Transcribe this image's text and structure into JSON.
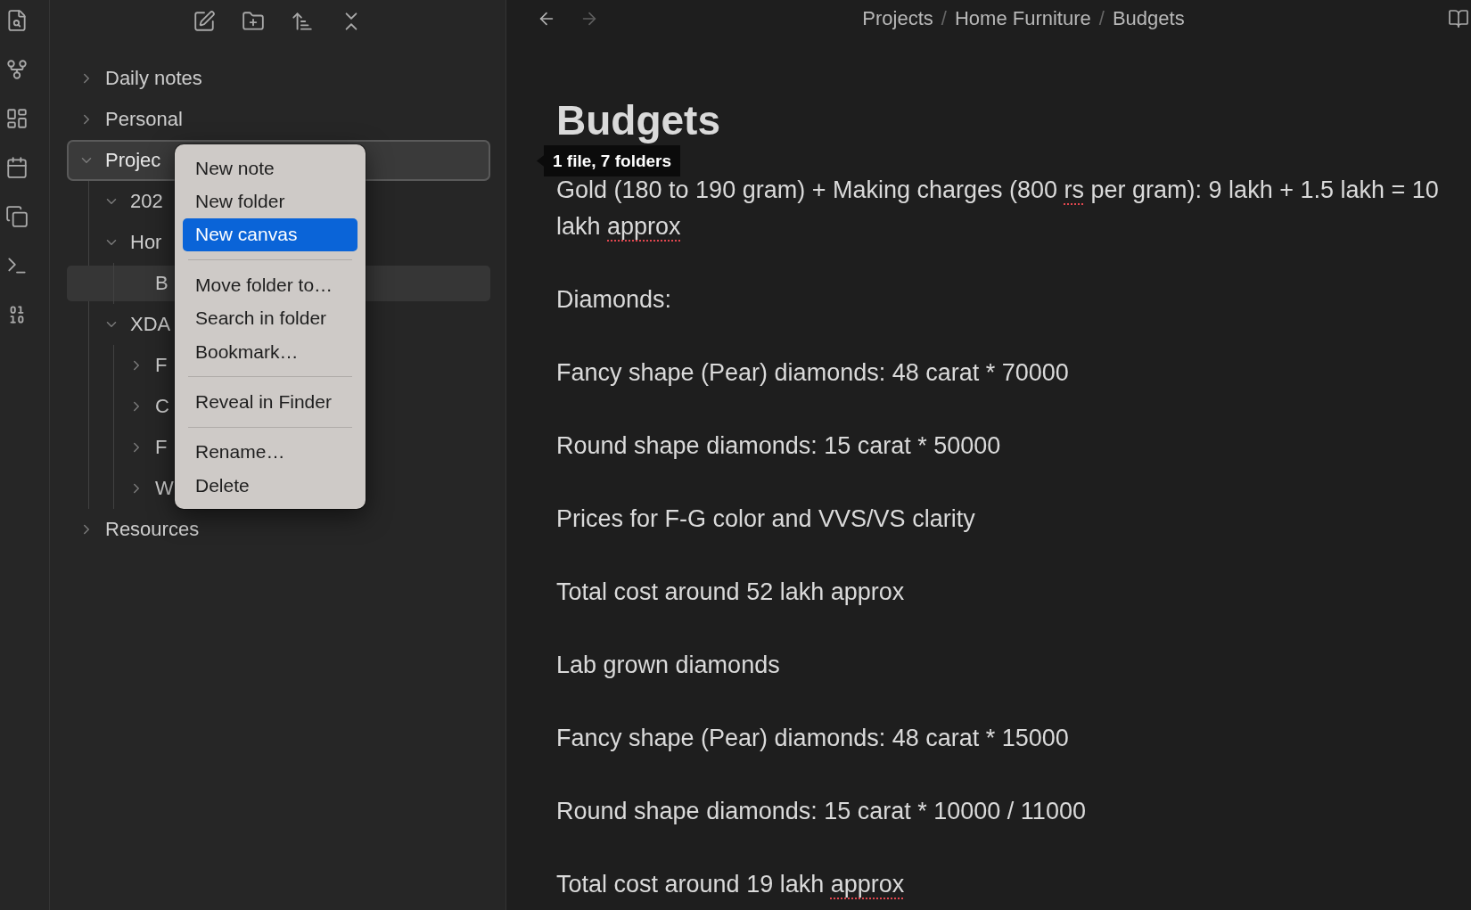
{
  "sidebar": {
    "tree": [
      {
        "label": "Daily notes",
        "kind": "folder",
        "expanded": false,
        "selected": false,
        "active": false
      },
      {
        "label": "Personal",
        "kind": "folder",
        "expanded": false,
        "selected": false,
        "active": false
      },
      {
        "label": "Projec",
        "kind": "folder",
        "expanded": true,
        "selected": true,
        "active": false,
        "children": [
          {
            "label": "202",
            "kind": "folder",
            "expanded": true,
            "selected": false,
            "active": false
          },
          {
            "label": "Hor",
            "kind": "folder",
            "expanded": true,
            "selected": false,
            "active": false,
            "children": [
              {
                "label": "B",
                "kind": "file",
                "selected": false,
                "active": true
              }
            ]
          },
          {
            "label": "XDA",
            "kind": "folder",
            "expanded": true,
            "selected": false,
            "active": false,
            "children": [
              {
                "label": "F",
                "kind": "folder",
                "expanded": false,
                "selected": false,
                "active": false
              },
              {
                "label": "C",
                "kind": "folder",
                "expanded": false,
                "selected": false,
                "active": false
              },
              {
                "label": "F",
                "kind": "folder",
                "expanded": false,
                "selected": false,
                "active": false
              },
              {
                "label": "W",
                "kind": "folder",
                "expanded": false,
                "selected": false,
                "active": false
              }
            ]
          }
        ]
      },
      {
        "label": "Resources",
        "kind": "folder",
        "expanded": false,
        "selected": false,
        "active": false
      }
    ]
  },
  "context_menu": {
    "items": [
      {
        "kind": "item",
        "label": "New note",
        "selected": false
      },
      {
        "kind": "item",
        "label": "New folder",
        "selected": false
      },
      {
        "kind": "item",
        "label": "New canvas",
        "selected": true
      },
      {
        "kind": "separator"
      },
      {
        "kind": "item",
        "label": "Move folder to…",
        "selected": false
      },
      {
        "kind": "item",
        "label": "Search in folder",
        "selected": false
      },
      {
        "kind": "item",
        "label": "Bookmark…",
        "selected": false
      },
      {
        "kind": "separator"
      },
      {
        "kind": "item",
        "label": "Reveal in Finder",
        "selected": false
      },
      {
        "kind": "separator"
      },
      {
        "kind": "item",
        "label": "Rename…",
        "selected": false
      },
      {
        "kind": "item",
        "label": "Delete",
        "selected": false
      }
    ]
  },
  "history_buttons": [
    {
      "kind": "back",
      "disabled": false
    },
    {
      "kind": "forward",
      "disabled": true
    }
  ],
  "breadcrumb": [
    {
      "kind": "link",
      "text": "Projects"
    },
    {
      "kind": "separator",
      "text": "/"
    },
    {
      "kind": "link",
      "text": "Home Furniture"
    },
    {
      "kind": "separator",
      "text": "/"
    },
    {
      "kind": "link",
      "text": "Budgets"
    }
  ],
  "note": {
    "title": "Budgets",
    "paragraphs": [
      {
        "segments": [
          {
            "text": "Gold (180 to 190 gram) + Making charges (800 ",
            "misspelled": false
          },
          {
            "text": "rs",
            "misspelled": true
          },
          {
            "text": " per gram): 9 lakh + 1.5 lakh = 10 lakh ",
            "misspelled": false
          },
          {
            "text": "approx",
            "misspelled": true
          }
        ]
      },
      {
        "segments": [
          {
            "text": "Diamonds:",
            "misspelled": false
          }
        ]
      },
      {
        "segments": [
          {
            "text": "Fancy shape (Pear) diamonds: 48 carat * 70000",
            "misspelled": false
          }
        ]
      },
      {
        "segments": [
          {
            "text": "Round shape diamonds: 15 carat * 50000",
            "misspelled": false
          }
        ]
      },
      {
        "segments": [
          {
            "text": "Prices for F-G color and VVS/VS clarity",
            "misspelled": false
          }
        ]
      },
      {
        "segments": [
          {
            "text": "Total cost around 52 lakh approx",
            "misspelled": false
          }
        ]
      },
      {
        "segments": [
          {
            "text": "Lab grown diamonds",
            "misspelled": false
          }
        ]
      },
      {
        "segments": [
          {
            "text": "Fancy shape (Pear) diamonds: 48 carat * 15000",
            "misspelled": false
          }
        ]
      },
      {
        "segments": [
          {
            "text": "Round shape diamonds: 15 carat * 10000 / 11000",
            "misspelled": false
          }
        ]
      },
      {
        "segments": [
          {
            "text": "Total cost around 19 lakh ",
            "misspelled": false
          },
          {
            "text": "approx",
            "misspelled": true
          }
        ]
      }
    ]
  },
  "tooltip": {
    "text": "1 file, 7 folders"
  }
}
